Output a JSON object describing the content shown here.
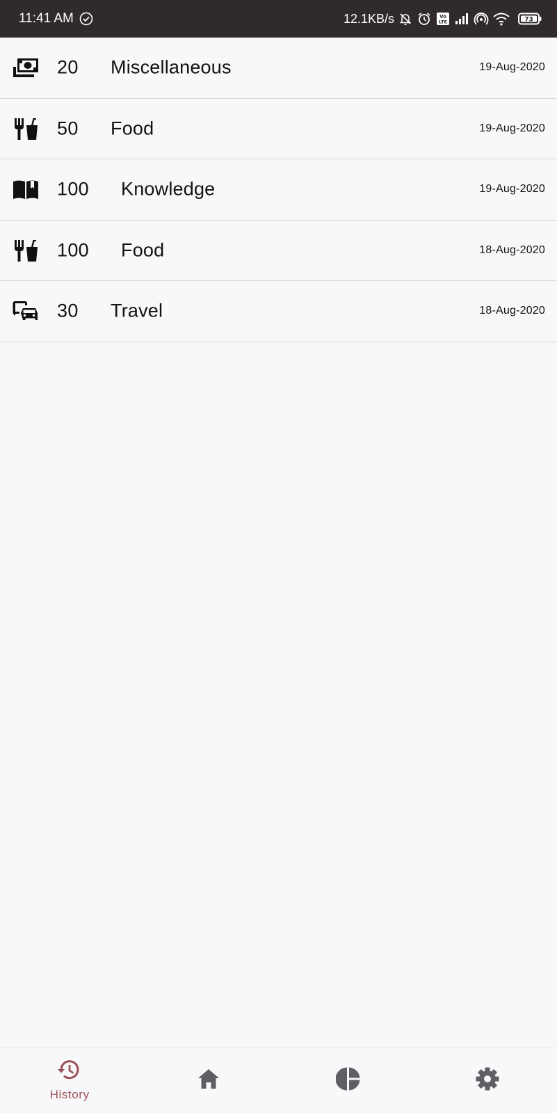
{
  "status_bar": {
    "time": "11:41 AM",
    "network_speed": "12.1KB/s",
    "battery_level": "73",
    "icons": [
      "check-circle-icon",
      "bell-off-icon",
      "alarm-icon",
      "volte-icon",
      "signal-icon",
      "hotspot-icon",
      "wifi-icon",
      "battery-icon"
    ]
  },
  "expenses": [
    {
      "icon": "money-icon",
      "amount": "20",
      "category": "Miscellaneous",
      "date": "19-Aug-2020"
    },
    {
      "icon": "food-icon",
      "amount": "50",
      "category": "Food",
      "date": "19-Aug-2020"
    },
    {
      "icon": "book-icon",
      "amount": "100",
      "category": "Knowledge",
      "date": "19-Aug-2020"
    },
    {
      "icon": "food-icon",
      "amount": "100",
      "category": "Food",
      "date": "18-Aug-2020"
    },
    {
      "icon": "commute-icon",
      "amount": "30",
      "category": "Travel",
      "date": "18-Aug-2020"
    }
  ],
  "bottom_nav": {
    "items": [
      {
        "icon": "history-icon",
        "label": "History",
        "active": true
      },
      {
        "icon": "home-icon",
        "label": "",
        "active": false
      },
      {
        "icon": "pie-chart-icon",
        "label": "",
        "active": false
      },
      {
        "icon": "settings-icon",
        "label": "",
        "active": false
      }
    ],
    "active_color": "#9b4f56",
    "inactive_color": "#5f5f63"
  },
  "colors": {
    "status_bar_bg": "#302b2a",
    "page_bg": "#f8f8fa",
    "divider": "#d6d6d9"
  }
}
